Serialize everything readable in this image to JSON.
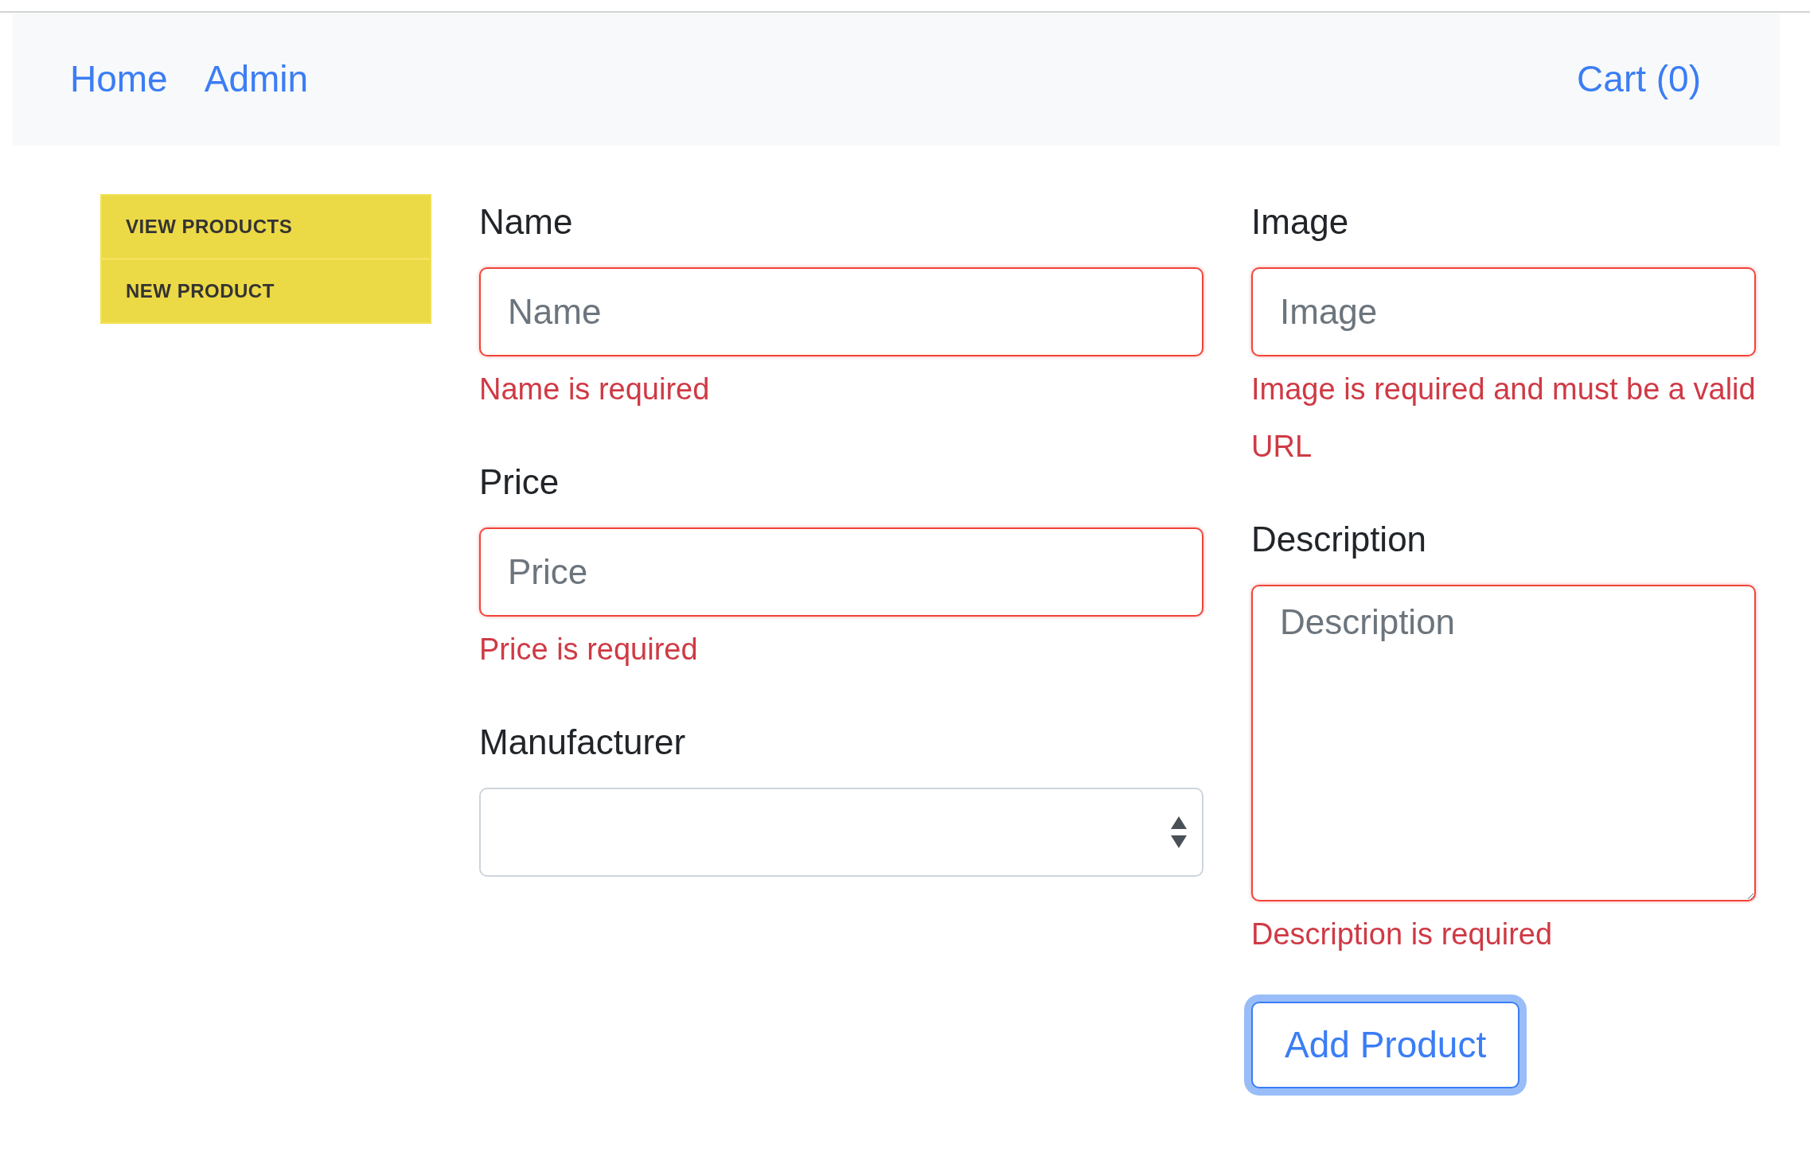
{
  "navbar": {
    "links": [
      {
        "label": "Home"
      },
      {
        "label": "Admin"
      }
    ],
    "cart": "Cart (0)"
  },
  "sidebar": {
    "items": [
      {
        "label": "VIEW PRODUCTS"
      },
      {
        "label": "NEW PRODUCT"
      }
    ]
  },
  "form": {
    "columns": [
      [
        {
          "kind": "input",
          "label": "Name",
          "placeholder": "Name",
          "invalid": true,
          "error": "Name is required"
        },
        {
          "kind": "input",
          "label": "Price",
          "placeholder": "Price",
          "invalid": true,
          "error": "Price is required"
        },
        {
          "kind": "select",
          "label": "Manufacturer",
          "invalid": false
        }
      ],
      [
        {
          "kind": "input",
          "label": "Image",
          "placeholder": "Image",
          "invalid": true,
          "error": "Image is required and must be a valid URL"
        },
        {
          "kind": "textarea",
          "label": "Description",
          "placeholder": "Description",
          "invalid": true,
          "error": "Description is required"
        }
      ]
    ],
    "submit": {
      "label": "Add Product",
      "focused": true
    }
  }
}
